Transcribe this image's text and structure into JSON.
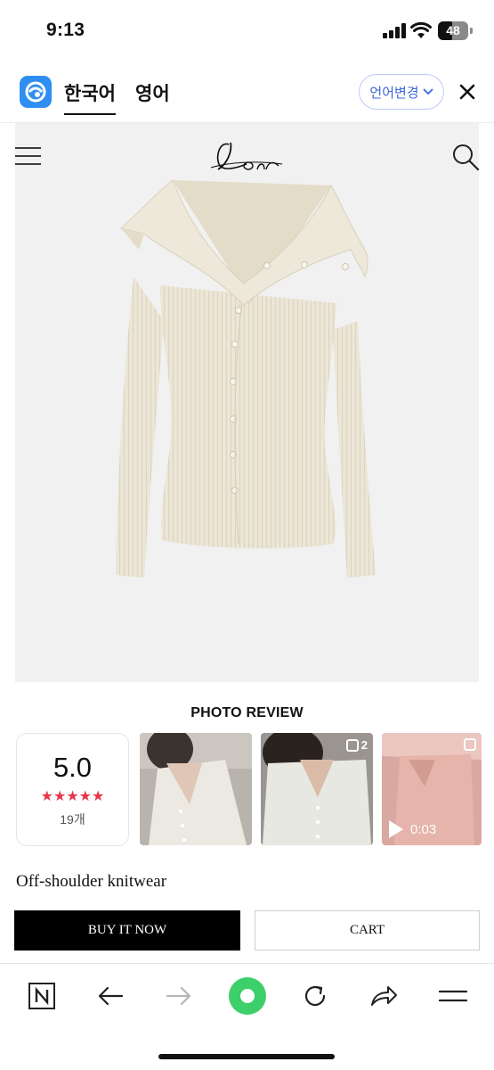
{
  "status_bar": {
    "time": "9:13",
    "battery": "48",
    "battery_level": 0.48
  },
  "translate_bar": {
    "lang_active": "한국어",
    "lang_other": "영어",
    "change_button": "언어변경"
  },
  "product": {
    "brand": "Loar",
    "name": "Off-shoulder knitwear",
    "buy_label": "BUY IT NOW",
    "cart_label": "CART"
  },
  "review": {
    "title": "PHOTO REVIEW",
    "score": "5.0",
    "stars": "★★★★★",
    "count": "19개",
    "thumbs": [
      {
        "badge": ""
      },
      {
        "badge": "2"
      },
      {
        "badge": "",
        "video_duration": "0:03"
      }
    ]
  },
  "colors": {
    "accent_blue": "#3c66d8",
    "star_red": "#e8364a",
    "refresh_green": "#3ccf6a",
    "knit_cream": "#ece6d6"
  },
  "icons": [
    "hamburger-menu-icon",
    "search-icon",
    "close-icon",
    "naver-n-icon",
    "back-arrow-icon",
    "forward-arrow-icon",
    "green-home-icon",
    "refresh-icon",
    "share-icon",
    "menu-icon"
  ]
}
